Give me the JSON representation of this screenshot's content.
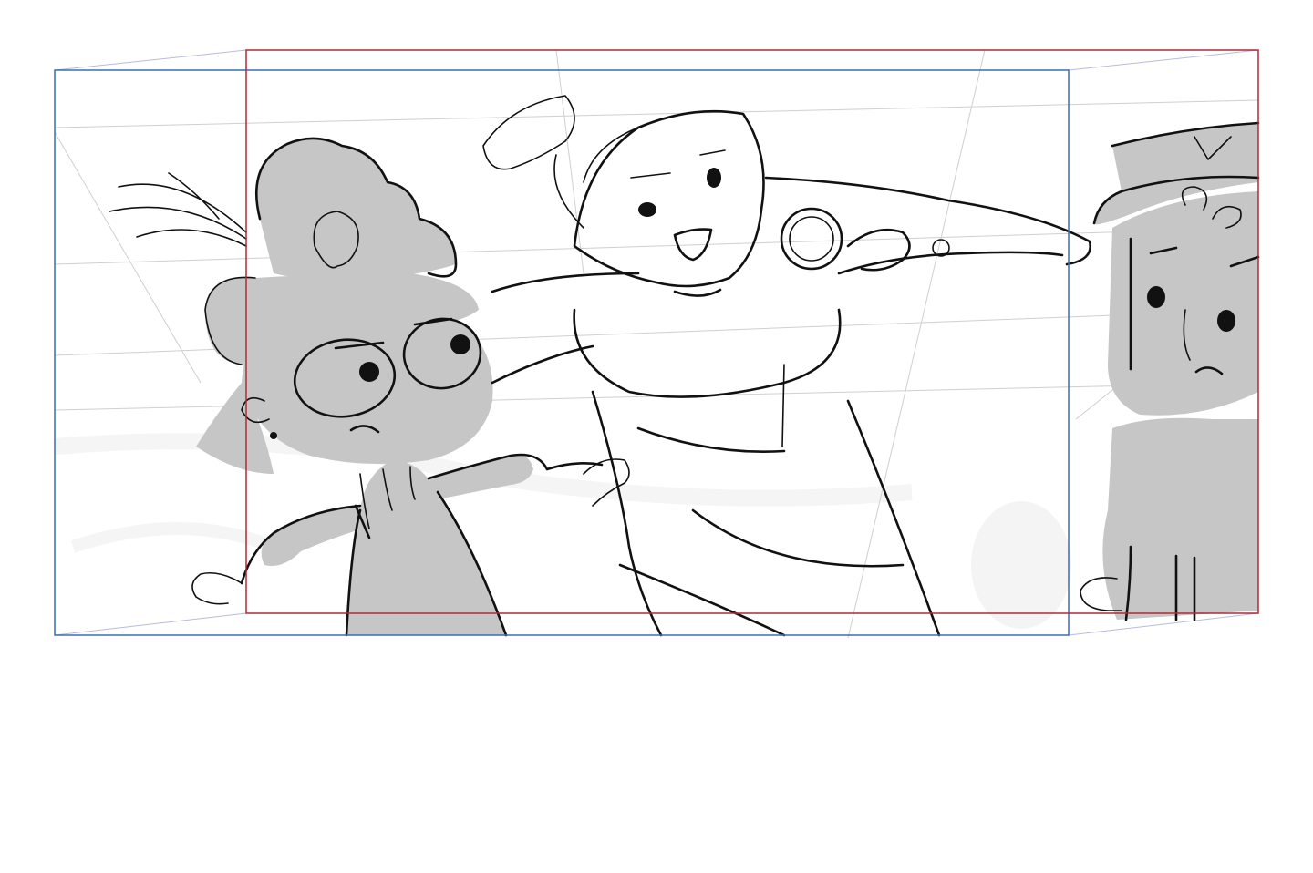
{
  "canvas": {
    "background": "#ffffff"
  },
  "colors": {
    "blue_frame": "#3a6db8",
    "red_frame": "#b0283a",
    "perspective_guide": "#b8bcd8",
    "grid_guide": "#cfcfcf",
    "character_fill": "#c6c6c6",
    "ink": "#111111",
    "smudge": "#ececec"
  },
  "scene": {
    "type": "storyboard-sketch",
    "characters": [
      {
        "name": "left-character",
        "has_hat": true,
        "has_glasses": true,
        "fill": "gray"
      },
      {
        "name": "center-character",
        "has_microphone": true,
        "fill": "white"
      },
      {
        "name": "right-character",
        "has_hat": true,
        "fill": "gray",
        "cropped": true
      }
    ],
    "frames": [
      {
        "name": "blue-camera-frame"
      },
      {
        "name": "red-camera-frame"
      }
    ]
  }
}
